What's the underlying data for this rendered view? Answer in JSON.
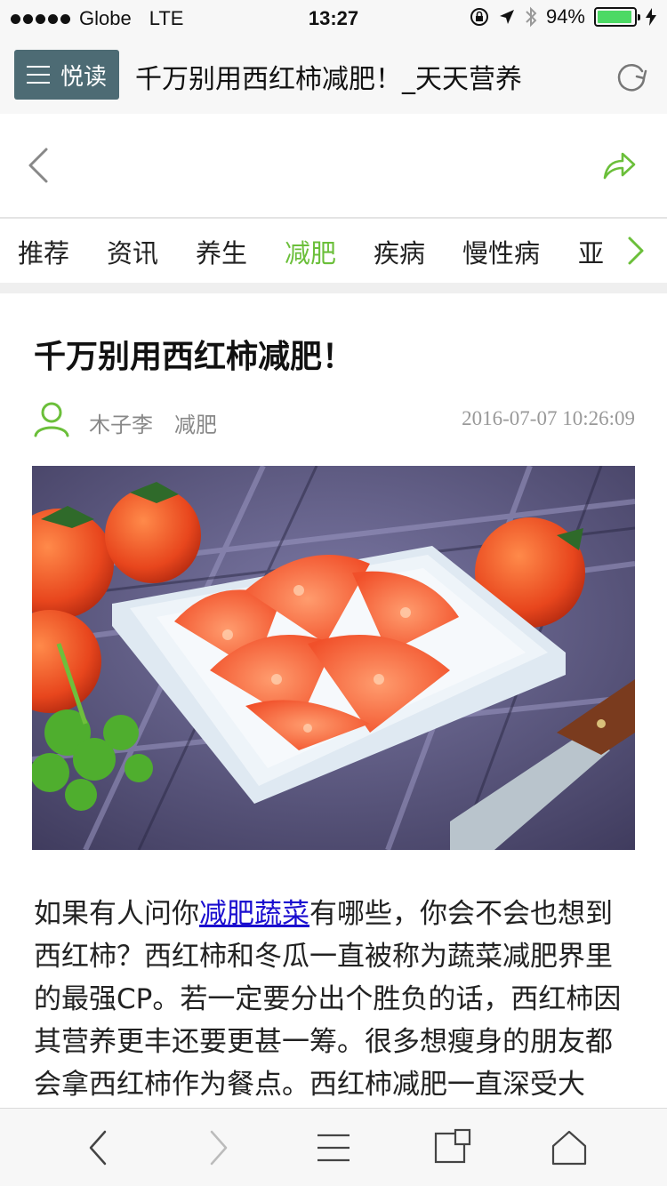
{
  "status_bar": {
    "carrier": "Globe",
    "network": "LTE",
    "time": "13:27",
    "battery_percent": "94%",
    "battery_level": 0.94
  },
  "header": {
    "menu_label": "悦读",
    "page_title": "千万别用西红柿减肥！_天天营养"
  },
  "tabs": [
    {
      "label": "推荐",
      "active": false
    },
    {
      "label": "资讯",
      "active": false
    },
    {
      "label": "养生",
      "active": false
    },
    {
      "label": "减肥",
      "active": true
    },
    {
      "label": "疾病",
      "active": false
    },
    {
      "label": "慢性病",
      "active": false
    },
    {
      "label": "亚",
      "active": false
    }
  ],
  "article": {
    "title": "千万别用西红柿减肥！",
    "author": "木子李",
    "category": "减肥",
    "date": "2016-07-07 10:26:09",
    "body_before_link": "如果有人问你",
    "body_link": "减肥蔬菜",
    "body_after_link": "有哪些，你会不会也想到西红柿？西红柿和冬瓜一直被称为蔬菜减肥界里的最强CP。若一定要分出个胜负的话，西红柿因其营养更丰还要更甚一筹。很多想瘦身的朋友都会拿西红柿作为餐点。西红柿减肥一直深受大"
  },
  "colors": {
    "accent_green": "#6bbf3a",
    "menu_button_bg": "#4d6b74",
    "link_blue": "#1a0dcf"
  },
  "icons": {
    "refresh": "refresh-icon",
    "back": "chevron-left-icon",
    "share": "share-icon",
    "tab_more": "chevron-right-icon",
    "author": "user-icon",
    "browser_back": "arrow-left-icon",
    "browser_forward": "arrow-right-icon",
    "browser_menu": "menu-icon",
    "browser_tabs": "tabs-icon",
    "browser_home": "home-icon"
  }
}
